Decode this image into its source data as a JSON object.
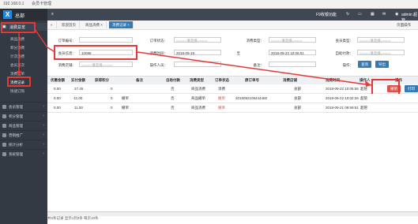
{
  "window": {
    "address": "192.168.0.1",
    "tab_title": "会员卡管理"
  },
  "logo": {
    "mark": "X",
    "text": "总部"
  },
  "sidebar": {
    "active_group": "消费总览",
    "active_sub": [
      "商品消费",
      "积分消费",
      "计次消费",
      "会员充次",
      "消费挂单",
      "消费记录",
      "快速订购"
    ],
    "groups": [
      {
        "label": "会员管理"
      },
      {
        "label": "积分管理"
      },
      {
        "label": "商品管理"
      },
      {
        "label": "营销推广"
      },
      {
        "label": "统计分析"
      },
      {
        "label": "系统管理"
      }
    ]
  },
  "topbar": {
    "menu_icon": "≡",
    "user_hint": "F9收银功能",
    "user": "admin 超管"
  },
  "tabs": {
    "back": "«",
    "items": [
      {
        "label": "欢迎首页"
      },
      {
        "label": "商品消费 ×"
      },
      {
        "label": "消费记录 ×"
      }
    ],
    "right_action": "页面操作"
  },
  "filter": {
    "order_no_label": "订单编号：",
    "order_no_value": "",
    "member_label": "会员信息：",
    "member_value": "10086",
    "type_label": "消费类型：",
    "type_value": "=====请选择=====",
    "order_state_label": "订单状态：",
    "order_state_value": "=====请选择=====",
    "time_label": "消费时间：",
    "time_value": "2018-09-19",
    "to_label": "至",
    "to_value": "2018-09-22 10:06:01",
    "from_type_label": "消费类型：",
    "from_type_value": "=====请选择=====",
    "store_label": "消费店铺：",
    "store_value": "=====请选择=====",
    "cashier_label": "操作人员：",
    "cashier_value": "",
    "remark_label": "备注：",
    "remark_value": "",
    "pay_label": "会员类型：",
    "pay_value": "=====请选择=====",
    "auto_label": "自助付款：",
    "auto_value": "=====请选择=====",
    "op_label": "操作：",
    "search_btn": "查询",
    "export_btn": "导出"
  },
  "table": {
    "headers": [
      "优惠金额",
      "实付金额",
      "获得积分",
      "备注",
      "自助付款",
      "消费类型",
      "订单状态",
      "原订单号",
      "消费店铺",
      "消费时间",
      "操作人",
      "操作"
    ],
    "rows": [
      {
        "discount": "0.00",
        "paid": "27.45",
        "points": "0",
        "remark": "",
        "auto": "否",
        "type": "商品消费",
        "state": "消费",
        "orig": "",
        "store": "总部",
        "time": "2018-09-22 10:05:55",
        "op": "超管",
        "action": "撤销",
        "action2": "打印"
      },
      {
        "discount": "0.00",
        "paid": "-11.00",
        "points": "0",
        "remark": "撤单",
        "auto": "否",
        "type": "商品撤单",
        "state": "撤单",
        "orig": "2018092109444455",
        "store": "总部",
        "time": "2018-09-22 10:02:26",
        "op": "超管",
        "action": "",
        "action2": ""
      },
      {
        "discount": "0.00",
        "paid": "11.00",
        "points": "0",
        "remark": "撤单",
        "auto": "否",
        "type": "商品消费",
        "state": "撤单",
        "orig": "",
        "store": "总部",
        "time": "2018-09-21 09:59:51",
        "op": "超管",
        "action": "",
        "action2": ""
      }
    ]
  },
  "status": {
    "text": "共3条记录 显示1到3条 每页10条"
  },
  "colors": {
    "sidebar": "#333a44",
    "accent": "#337ab7",
    "danger": "#d9534f",
    "annotation": "#e53935"
  }
}
